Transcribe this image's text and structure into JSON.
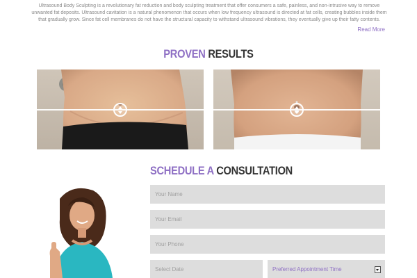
{
  "intro": {
    "text": "Ultrasound Body Sculpting is a revolutionary fat reduction and body sculpting treatment that offer consumers a safe, painless, and non-intrusive way to remove unwanted fat deposits. Ultrasound cavitation is a natural phenomenon that occurs when low frequency ultrasound is directed at fat cells, creating bubbles inside them that gradually grow. Since fat cell membranes do not have the structural capacity to withstand ultrasound vibrations, they eventually give up their fatty contents.",
    "read_more": "Read More"
  },
  "results": {
    "title_accent": "PROVEN",
    "title_rest": "RESULTS",
    "before_slider_level": 0.5,
    "after_slider_level": 0.5
  },
  "consultation": {
    "title_accent": "SCHEDULE A",
    "title_rest": "CONSULTATION",
    "name_placeholder": "Your Name",
    "email_placeholder": "Your Email",
    "phone_placeholder": "Your Phone",
    "date_placeholder": "Select Date",
    "time_label": "Preferred Appointment Time"
  },
  "colors": {
    "accent": "#8e6fc4",
    "heading_dark": "#333333",
    "field_bg": "#dddddd"
  },
  "icons": {
    "slider_handle": "up-down-arrows-icon",
    "dropdown": "chevron-down-icon"
  }
}
